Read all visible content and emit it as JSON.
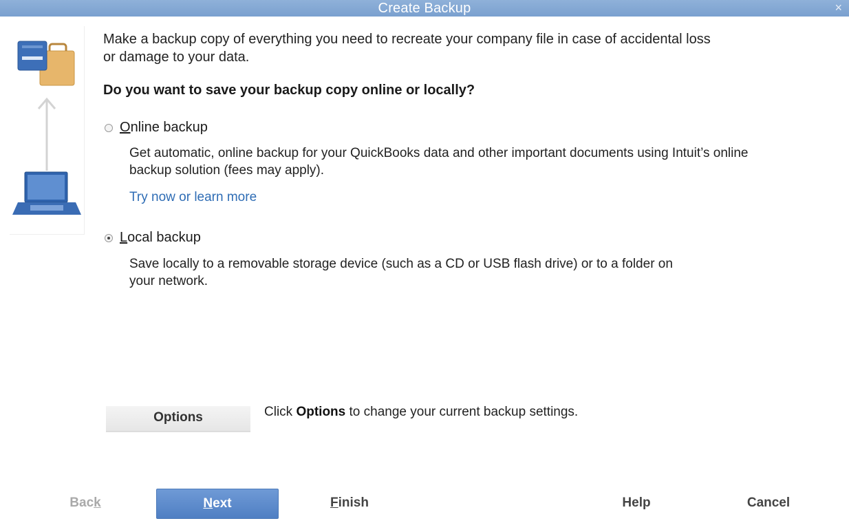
{
  "window": {
    "title": "Create Backup",
    "close_glyph": "×"
  },
  "intro": {
    "text": "Make a backup copy of everything you need to recreate your company file in case of accidental loss or damage to your data."
  },
  "question": "Do you want to save your backup copy online or locally?",
  "options": {
    "online": {
      "label_underlined": "O",
      "label_rest": "nline backup",
      "checked": false,
      "description": "Get automatic, online backup for your QuickBooks data and other important documents using Intuit’s online backup solution (fees may apply).",
      "link": "Try now or learn more"
    },
    "local": {
      "label_underlined": "L",
      "label_rest": "ocal backup",
      "checked": true,
      "description": "Save locally to a removable storage device (such as a CD or USB flash drive) or to a folder on your network."
    }
  },
  "settings": {
    "button_label": "Options",
    "hint_prefix": "Click ",
    "hint_bold": "Options",
    "hint_suffix": " to change your current backup settings."
  },
  "footer": {
    "back_pre": "Bac",
    "back_u": "k",
    "next_u": "N",
    "next_rest": "ext",
    "finish_u": "F",
    "finish_rest": "inish",
    "help": "Help",
    "cancel": "Cancel"
  },
  "icons": {
    "top": "backup-briefcase-icon",
    "arrow": "up-arrow-icon",
    "bottom": "laptop-icon"
  },
  "colors": {
    "titlebar": "#7aa0cf",
    "link": "#2f6db5",
    "primary_button": "#4f7fc3"
  }
}
